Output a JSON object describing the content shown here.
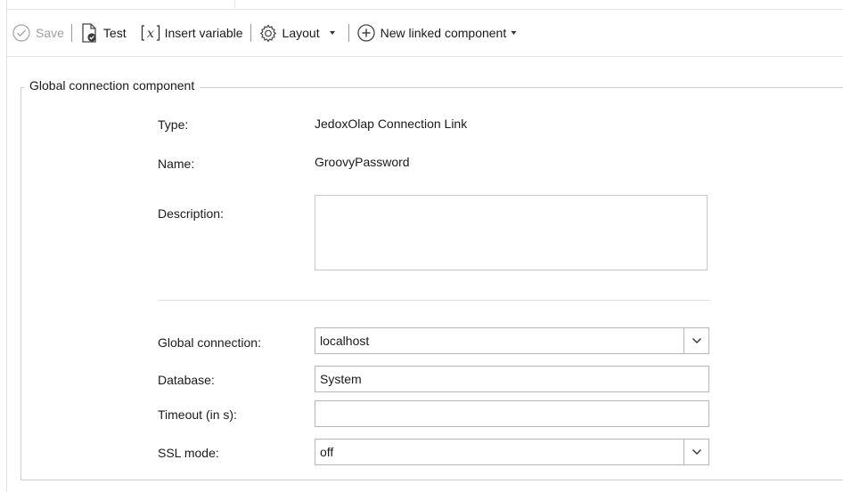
{
  "toolbar": {
    "save_label": "Save",
    "test_label": "Test",
    "insert_variable_label": "Insert variable",
    "layout_label": "Layout",
    "new_linked_label": "New linked component"
  },
  "group": {
    "legend": "Global connection component"
  },
  "details": {
    "type_label": "Type:",
    "type_value": "JedoxOlap Connection Link",
    "name_label": "Name:",
    "name_value": "GroovyPassword",
    "description_label": "Description:",
    "description_value": ""
  },
  "settings": {
    "global_connection_label": "Global connection:",
    "global_connection_value": "localhost",
    "database_label": "Database:",
    "database_value": "System",
    "timeout_label": "Timeout (in s):",
    "timeout_value": "",
    "ssl_label": "SSL mode:",
    "ssl_value": "off"
  }
}
